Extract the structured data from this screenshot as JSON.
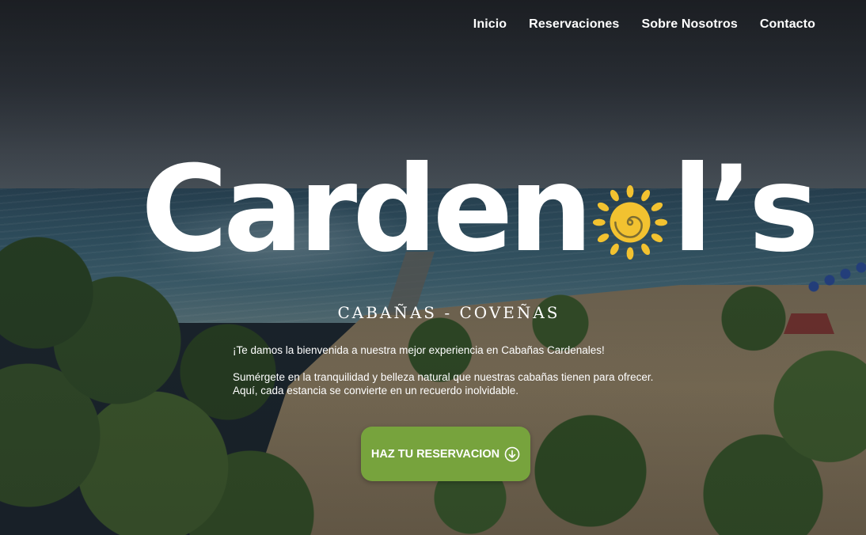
{
  "nav": {
    "items": [
      {
        "label": "Inicio"
      },
      {
        "label": "Reservaciones"
      },
      {
        "label": "Sobre Nosotros"
      },
      {
        "label": "Contacto"
      }
    ]
  },
  "hero": {
    "logo": {
      "before_sun": "Carden",
      "after_sun": "l’s",
      "sun_icon": "sun-icon",
      "sun_color": "#f2c230"
    },
    "subtitle": "CABAÑAS - COVEÑAS",
    "welcome": "¡Te damos la bienvenida a nuestra mejor experiencia en Cabañas Cardenales!",
    "description_line1": "Sumérgete en la tranquilidad y belleza natural que nuestras cabañas tienen para ofrecer.",
    "description_line2": "Aquí, cada estancia se convierte en un recuerdo inolvidable.",
    "cta": {
      "label": "HAZ TU RESERVACION",
      "icon": "arrow-down-circle-icon",
      "color": "#77a33d"
    }
  }
}
